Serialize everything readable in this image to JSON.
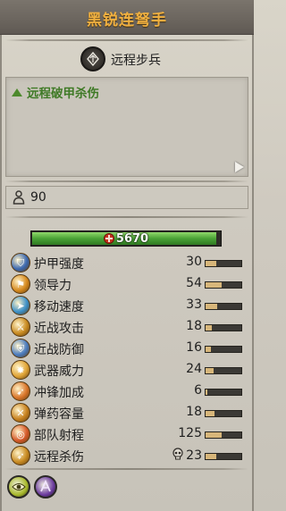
{
  "title": "黑锐连弩手",
  "unit_type": {
    "label": "远程步兵",
    "icon": "missile-infantry-icon"
  },
  "ability": {
    "label": "远程破甲杀伤",
    "icon": "triangle-up-icon",
    "color": "#3f7a26"
  },
  "unit_size": {
    "value": "90",
    "icon": "person-icon"
  },
  "health": {
    "value": "5670",
    "fraction": 0.98,
    "color": "#4aa236"
  },
  "stats": [
    {
      "label": "护甲强度",
      "value": "30",
      "fraction": 0.3,
      "icon": "armour-icon",
      "icon_color": "#3b68b0"
    },
    {
      "label": "领导力",
      "value": "54",
      "fraction": 0.45,
      "icon": "leadership-icon",
      "icon_color": "#d68a1f"
    },
    {
      "label": "移动速度",
      "value": "33",
      "fraction": 0.33,
      "icon": "speed-icon",
      "icon_color": "#3a8fc8"
    },
    {
      "label": "近战攻击",
      "value": "18",
      "fraction": 0.18,
      "icon": "melee-attack-icon",
      "icon_color": "#c98b22"
    },
    {
      "label": "近战防御",
      "value": "16",
      "fraction": 0.16,
      "icon": "melee-defence-icon",
      "icon_color": "#4a7bbf"
    },
    {
      "label": "武器威力",
      "value": "24",
      "fraction": 0.22,
      "icon": "weapon-strength-icon",
      "icon_color": "#e0a437"
    },
    {
      "label": "冲锋加成",
      "value": "6",
      "fraction": 0.06,
      "icon": "charge-bonus-icon",
      "icon_color": "#d9752a"
    },
    {
      "label": "弹药容量",
      "value": "18",
      "fraction": 0.25,
      "icon": "ammunition-icon",
      "icon_color": "#c8821f"
    },
    {
      "label": "部队射程",
      "value": "125",
      "fraction": 0.45,
      "icon": "range-icon",
      "icon_color": "#d65a2a"
    },
    {
      "label": "远程杀伤",
      "value": "23",
      "fraction": 0.3,
      "icon": "missile-damage-icon",
      "icon_color": "#c98b22",
      "extra_icon": "skull-icon"
    }
  ],
  "bottom_abilities": [
    {
      "icon": "eye-ability-icon",
      "color": "#a7b82a"
    },
    {
      "icon": "purple-ability-icon",
      "color": "#6b3a9e"
    }
  ]
}
